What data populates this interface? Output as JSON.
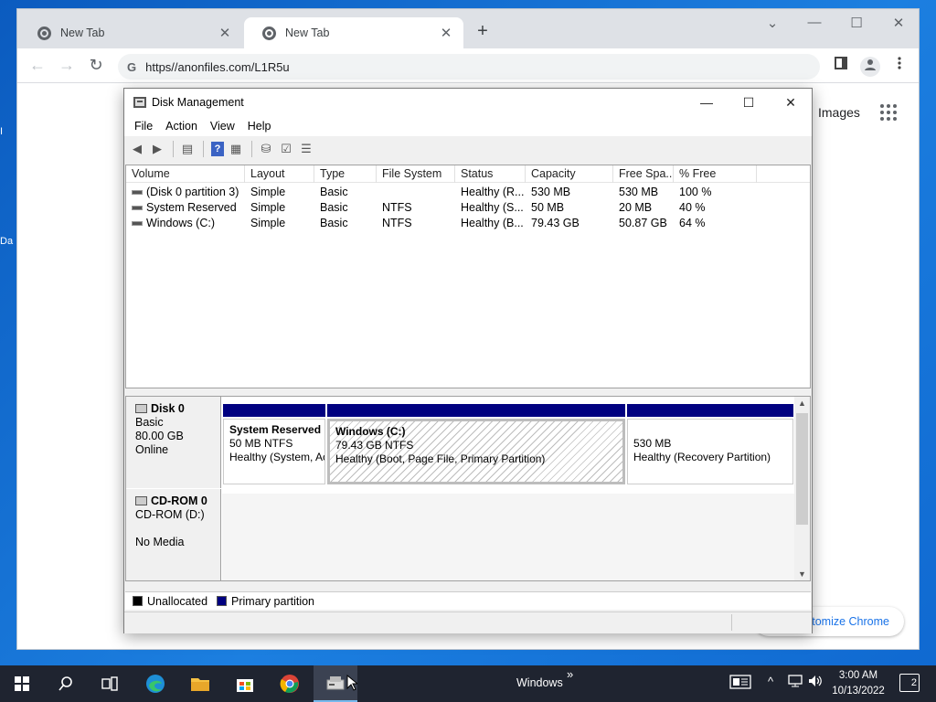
{
  "desktop": {
    "frag_top": "I",
    "frag_bottom": "Da"
  },
  "browser": {
    "tabs": [
      {
        "title": "New Tab",
        "close": "✕"
      },
      {
        "title": "New Tab",
        "close": "✕"
      }
    ],
    "new_tab": "+",
    "window_controls": [
      "⌄",
      "—",
      "☐",
      "✕"
    ],
    "url": "https//anonfiles.com/L1R5u",
    "omnibox_icon": "G",
    "nav": {
      "back": "←",
      "forward": "→",
      "reload": "↻"
    },
    "page": {
      "images_link": "Images",
      "customize_button": "Customize Chrome"
    }
  },
  "disk_mgmt": {
    "title": "Disk Management",
    "controls": {
      "minimize": "—",
      "maximize": "☐",
      "close": "✕"
    },
    "menu": [
      "File",
      "Action",
      "View",
      "Help"
    ],
    "columns": [
      "Volume",
      "Layout",
      "Type",
      "File System",
      "Status",
      "Capacity",
      "Free Spa...",
      "% Free"
    ],
    "volumes": [
      {
        "volume": "(Disk 0 partition 3)",
        "layout": "Simple",
        "type": "Basic",
        "fs": "",
        "status": "Healthy (R...",
        "capacity": "530 MB",
        "free": "530 MB",
        "pct": "100 %"
      },
      {
        "volume": "System Reserved",
        "layout": "Simple",
        "type": "Basic",
        "fs": "NTFS",
        "status": "Healthy (S...",
        "capacity": "50 MB",
        "free": "20 MB",
        "pct": "40 %"
      },
      {
        "volume": "Windows (C:)",
        "layout": "Simple",
        "type": "Basic",
        "fs": "NTFS",
        "status": "Healthy (B...",
        "capacity": "79.43 GB",
        "free": "50.87 GB",
        "pct": "64 %"
      }
    ],
    "disk0": {
      "name": "Disk 0",
      "type": "Basic",
      "size": "80.00 GB",
      "state": "Online",
      "partitions": [
        {
          "name": "System Reserved",
          "size": "50 MB NTFS",
          "status": "Healthy (System, Active, Primary Partition)"
        },
        {
          "name": "Windows  (C:)",
          "size": "79.43 GB NTFS",
          "status": "Healthy (Boot, Page File, Primary Partition)"
        },
        {
          "name": "",
          "size": "530 MB",
          "status": "Healthy (Recovery Partition)"
        }
      ]
    },
    "cdrom0": {
      "name": "CD-ROM 0",
      "drive": "CD-ROM (D:)",
      "media": "No Media"
    },
    "legend": [
      {
        "label": "Unallocated",
        "color": "#000000"
      },
      {
        "label": "Primary partition",
        "color": "#000080"
      }
    ]
  },
  "taskbar": {
    "running_label": "Windows",
    "chevron": "»",
    "clock_time": "3:00 AM",
    "clock_date": "10/13/2022",
    "notifications": "2"
  }
}
